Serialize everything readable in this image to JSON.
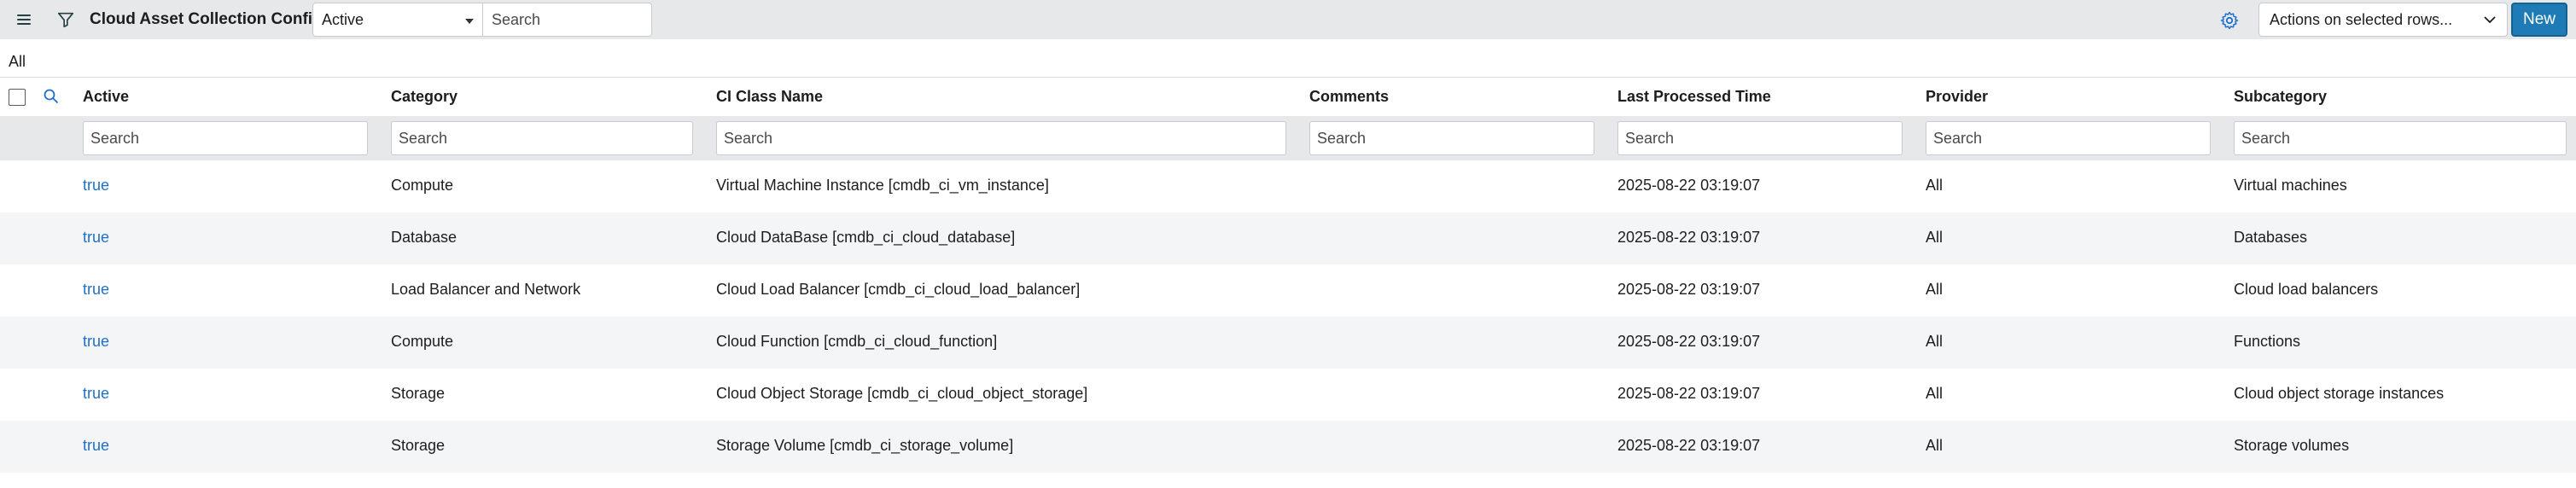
{
  "header": {
    "title": "Cloud Asset Collection Configs",
    "field_select_value": "Active",
    "search_placeholder": "Search",
    "actions_label": "Actions on selected rows...",
    "new_label": "New"
  },
  "breadcrumb": {
    "label": "All"
  },
  "columns": [
    {
      "key": "active",
      "label": "Active",
      "search_placeholder": "Search"
    },
    {
      "key": "category",
      "label": "Category",
      "search_placeholder": "Search"
    },
    {
      "key": "ci_class_name",
      "label": "CI Class Name",
      "search_placeholder": "Search"
    },
    {
      "key": "comments",
      "label": "Comments",
      "search_placeholder": "Search"
    },
    {
      "key": "last_processed_time",
      "label": "Last Processed Time",
      "search_placeholder": "Search"
    },
    {
      "key": "provider",
      "label": "Provider",
      "search_placeholder": "Search"
    },
    {
      "key": "subcategory",
      "label": "Subcategory",
      "search_placeholder": "Search"
    }
  ],
  "rows": [
    {
      "active": "true",
      "category": "Compute",
      "ci_class_name": "Virtual Machine Instance [cmdb_ci_vm_instance]",
      "comments": "",
      "last_processed_time": "2025-08-22 03:19:07",
      "provider": "All",
      "subcategory": "Virtual machines"
    },
    {
      "active": "true",
      "category": "Database",
      "ci_class_name": "Cloud DataBase [cmdb_ci_cloud_database]",
      "comments": "",
      "last_processed_time": "2025-08-22 03:19:07",
      "provider": "All",
      "subcategory": "Databases"
    },
    {
      "active": "true",
      "category": "Load Balancer and Network",
      "ci_class_name": "Cloud Load Balancer [cmdb_ci_cloud_load_balancer]",
      "comments": "",
      "last_processed_time": "2025-08-22 03:19:07",
      "provider": "All",
      "subcategory": "Cloud load balancers"
    },
    {
      "active": "true",
      "category": "Compute",
      "ci_class_name": "Cloud Function [cmdb_ci_cloud_function]",
      "comments": "",
      "last_processed_time": "2025-08-22 03:19:07",
      "provider": "All",
      "subcategory": "Functions"
    },
    {
      "active": "true",
      "category": "Storage",
      "ci_class_name": "Cloud Object Storage [cmdb_ci_cloud_object_storage]",
      "comments": "",
      "last_processed_time": "2025-08-22 03:19:07",
      "provider": "All",
      "subcategory": "Cloud object storage instances"
    },
    {
      "active": "true",
      "category": "Storage",
      "ci_class_name": "Storage Volume [cmdb_ci_storage_volume]",
      "comments": "",
      "last_processed_time": "2025-08-22 03:19:07",
      "provider": "All",
      "subcategory": "Storage volumes"
    }
  ],
  "colors": {
    "header_bg": "#e6e8ea",
    "link": "#1e6fc8",
    "primary_button": "#1e7bb5",
    "alt_row": "#f4f5f6"
  }
}
